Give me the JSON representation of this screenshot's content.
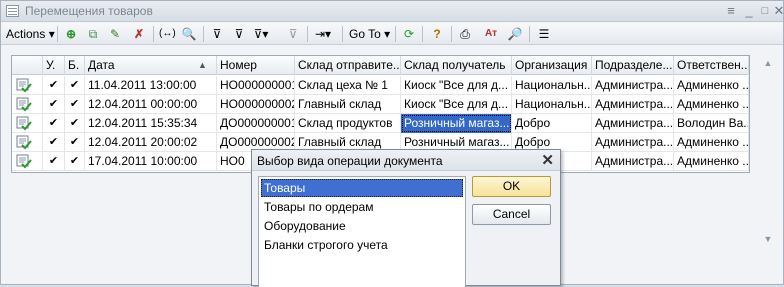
{
  "window": {
    "title": "Перемещения товаров"
  },
  "toolbar": {
    "actions_label": "Actions",
    "goto_label": "Go To"
  },
  "table": {
    "columns": [
      "",
      "У.",
      "Б.",
      "Дата",
      "Номер",
      "Склад отправите...",
      "Склад получатель",
      "Организация",
      "Подразделе...",
      "Ответствен..."
    ],
    "rows": [
      {
        "u": "✔",
        "b": "✔",
        "date": "11.04.2011 13:00:00",
        "number": "НО000000001",
        "from": "Склад цеха № 1",
        "to": "Киоск \"Все для д...",
        "org": "Национальн...",
        "dept": "Администра...",
        "resp": "Админенко ..."
      },
      {
        "u": "✔",
        "b": "✔",
        "date": "12.04.2011 00:00:00",
        "number": "НО000000002",
        "from": "Главный склад",
        "to": "Киоск \"Все для д...",
        "org": "Национальн...",
        "dept": "Администра...",
        "resp": "Админенко ..."
      },
      {
        "u": "✔",
        "b": "✔",
        "date": "12.04.2011 15:35:34",
        "number": "ДО000000001",
        "from": "Склад продуктов",
        "to": "Розничный магаз...",
        "org": "Добро",
        "dept": "Администра...",
        "resp": "Володин Ва..."
      },
      {
        "u": "✔",
        "b": "✔",
        "date": "12.04.2011 20:00:02",
        "number": "ДО000000002",
        "from": "Главный склад",
        "to": "Розничный магаз...",
        "org": "Добро",
        "dept": "Администра...",
        "resp": "Админенко ..."
      },
      {
        "u": "✔",
        "b": "✔",
        "date": "17.04.2011 10:00:00",
        "number": "НО0",
        "from": "",
        "to": "",
        "org": "",
        "dept": "Администра...",
        "resp": "Админенко ..."
      }
    ]
  },
  "dialog": {
    "title": "Выбор вида операции документа",
    "items": [
      "Товары",
      "Товары по ордерам",
      "Оборудование",
      "Бланки строгого учета"
    ],
    "ok_label": "OK",
    "cancel_label": "Cancel"
  }
}
